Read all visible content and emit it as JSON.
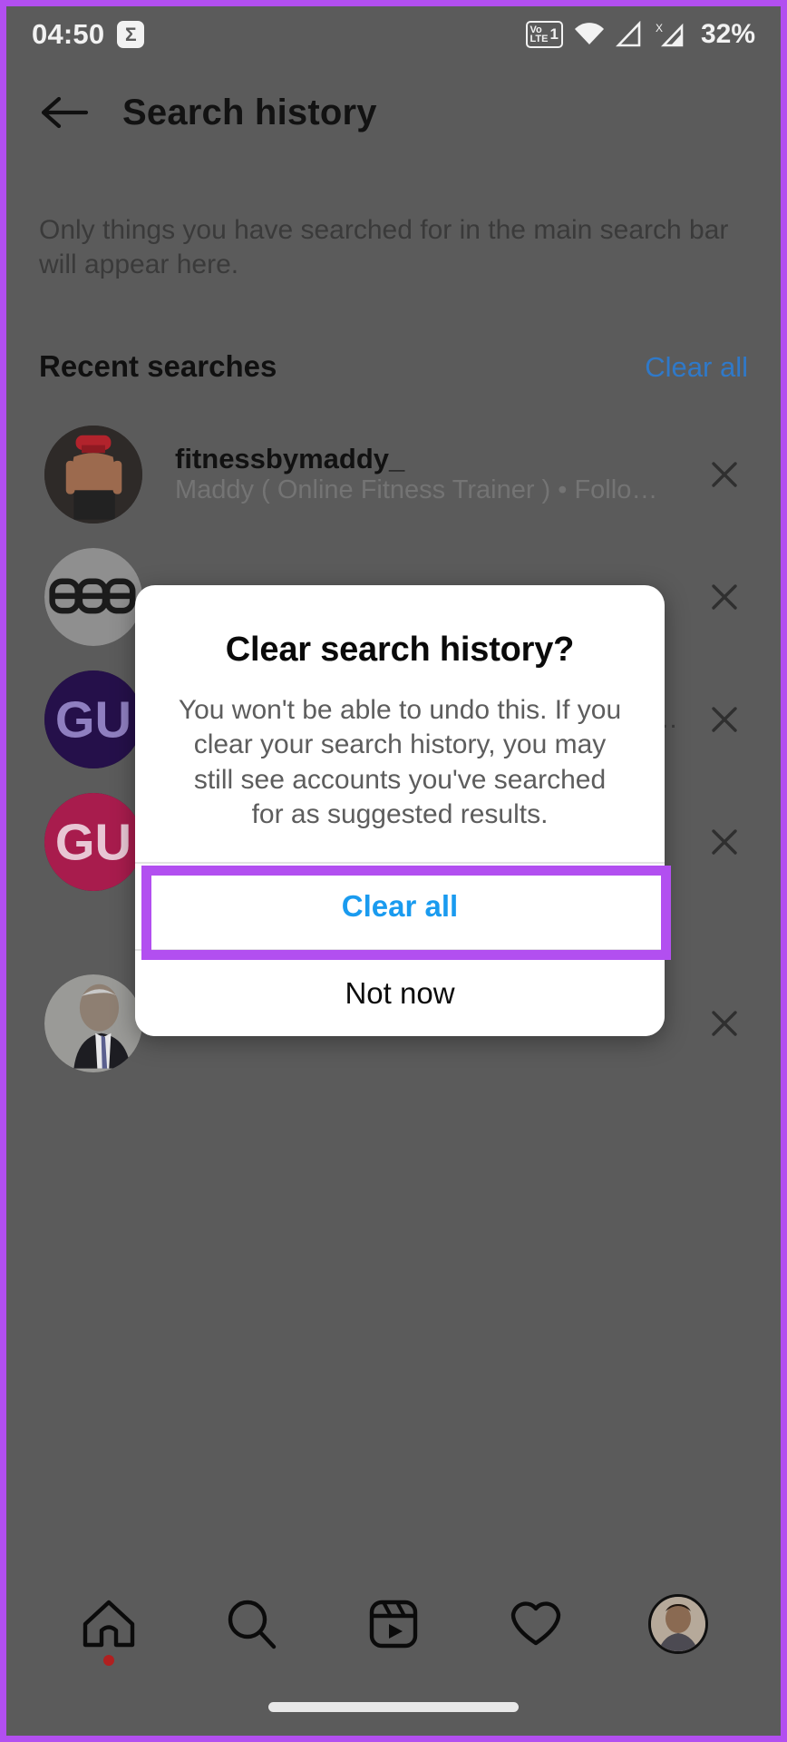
{
  "meta": {
    "accent_purple": "#b24ff0",
    "link_blue": "#2f79c9",
    "primary_blue": "#1a9bef",
    "app_bg": "#5b5b5b",
    "dialog_bg": "#ffffff"
  },
  "statusbar": {
    "time": "04:50",
    "sigma_label": "Σ",
    "volte_line1": "Vo",
    "volte_line2": "LTE",
    "volte_sim": "1",
    "signal2_label": "X",
    "battery": "32%",
    "icons": [
      "sigma-icon",
      "volte-icon",
      "wifi-icon",
      "signal-icon",
      "signal-no-service-icon"
    ]
  },
  "appbar": {
    "back_icon": "back-arrow-icon",
    "title": "Search history"
  },
  "description": "Only things you have searched for in the main search bar will appear here.",
  "recent": {
    "heading": "Recent searches",
    "clear_all_label": "Clear all"
  },
  "rows": [
    {
      "username": "fitnessbymaddy_",
      "subtitle": "Maddy ( Online Fitness Trainer ) • Follo…",
      "avatar": "fitness-trainer-photo",
      "remove_icon": "close-icon"
    },
    {
      "username": "",
      "subtitle": "",
      "avatar": "abs-wordmark-logo",
      "remove_icon": "close-icon"
    },
    {
      "username": "",
      "subtitle": "",
      "avatar": "gu-logo-navy",
      "remove_icon": "close-icon",
      "trailing_ellipsis": "…"
    },
    {
      "username": "",
      "subtitle": "",
      "avatar": "gu-logo-crimson",
      "remove_icon": "close-icon"
    },
    {
      "username": "",
      "subtitle": "",
      "avatar": "businessman-portrait-photo",
      "remove_icon": "close-icon"
    }
  ],
  "dialog": {
    "title": "Clear search history?",
    "text": "You won't be able to undo this. If you clear your search history, you may still see accounts you've searched for as suggested results.",
    "primary_label": "Clear all",
    "secondary_label": "Not now"
  },
  "bottomnav": {
    "items": [
      {
        "name": "home",
        "icon": "home-icon",
        "badge": true
      },
      {
        "name": "search",
        "icon": "search-icon",
        "badge": false
      },
      {
        "name": "reels",
        "icon": "reels-icon",
        "badge": false
      },
      {
        "name": "activity",
        "icon": "heart-icon",
        "badge": false
      },
      {
        "name": "profile",
        "icon": "profile-avatar",
        "badge": false
      }
    ]
  }
}
